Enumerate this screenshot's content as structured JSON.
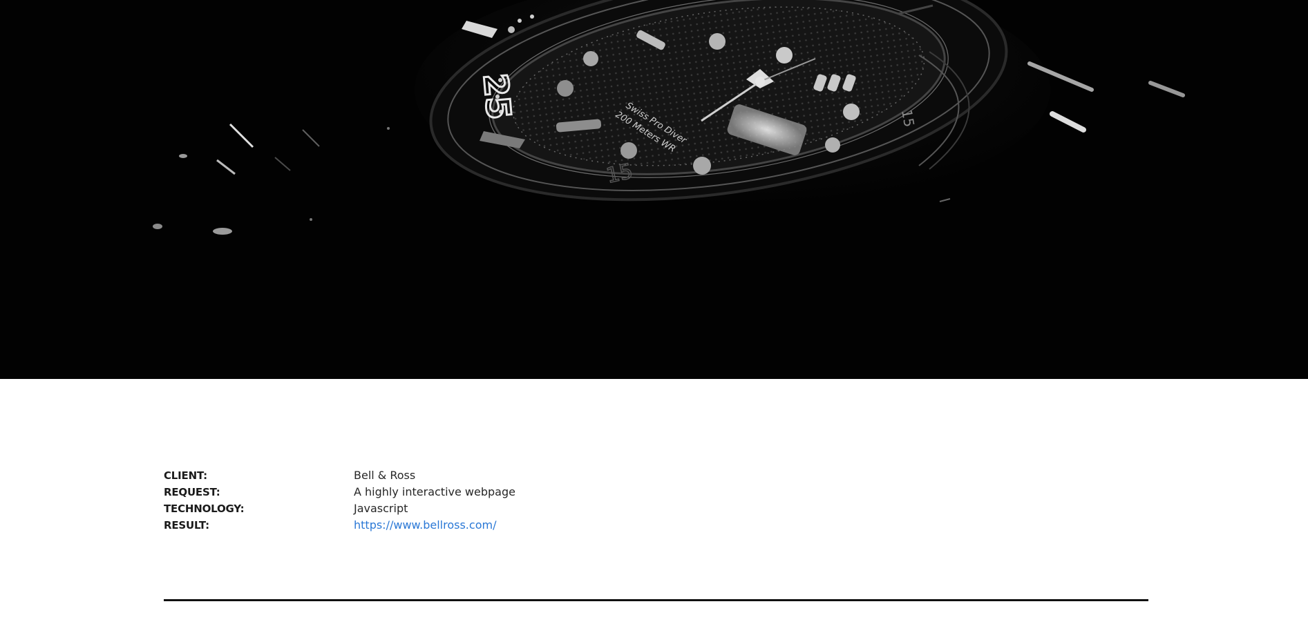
{
  "hero": {
    "image_name": "dark-dive-watch-photo",
    "dial_text_line1": "Swiss Pro Diver",
    "dial_text_line2": "200 Meters WR",
    "bezel_number": "25",
    "bezel_number2": "15",
    "bezel_number3": "15"
  },
  "details": {
    "client_label": "CLIENT:",
    "client_value": "Bell & Ross",
    "request_label": "REQUEST:",
    "request_value": "A highly interactive webpage",
    "technology_label": "TECHNOLOGY:",
    "technology_value": "Javascript",
    "result_label": "RESULT:",
    "result_value": "https://www.bellross.com/"
  },
  "colors": {
    "hero_background": "#020202",
    "link": "#2a78d6",
    "divider": "#111111"
  }
}
